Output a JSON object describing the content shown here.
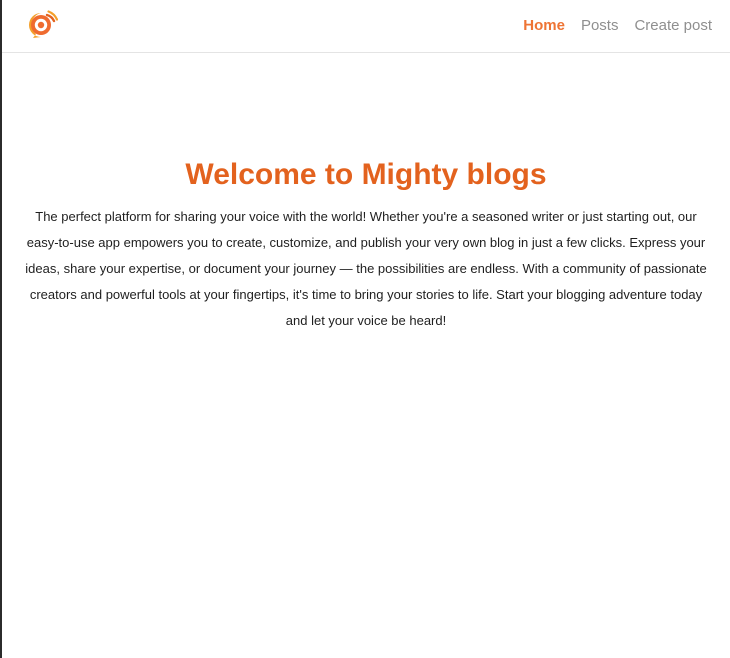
{
  "brand": {
    "logo_icon": "chat-bubble-signal-icon",
    "accent_color": "#e3621e"
  },
  "nav": {
    "items": [
      {
        "label": "Home",
        "active": true
      },
      {
        "label": "Posts",
        "active": false
      },
      {
        "label": "Create post",
        "active": false
      }
    ]
  },
  "hero": {
    "title": "Welcome to Mighty blogs",
    "body": "The perfect platform for sharing your voice with the world! Whether you're a seasoned writer or just starting out, our easy-to-use app empowers you to create, customize, and publish your very own blog in just a few clicks. Express your ideas, share your expertise, or document your journey — the possibilities are endless. With a community of passionate creators and powerful tools at your fingertips, it's time to bring your stories to life. Start your blogging adventure today and let your voice be heard!"
  }
}
